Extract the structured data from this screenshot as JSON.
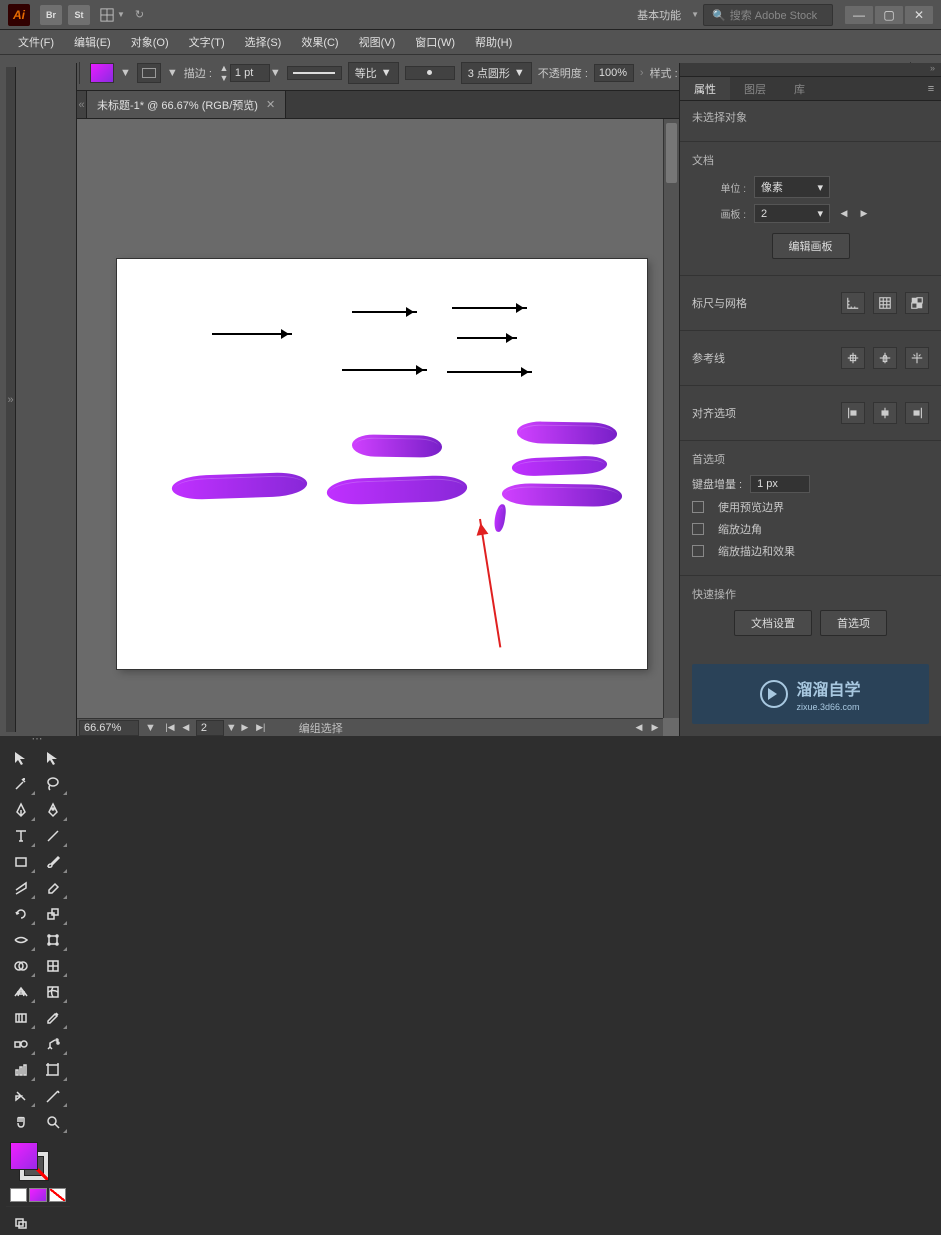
{
  "titlebar": {
    "workspace_label": "基本功能",
    "search_placeholder": "搜索 Adobe Stock"
  },
  "menu": {
    "file": "文件(F)",
    "edit": "编辑(E)",
    "object": "对象(O)",
    "type": "文字(T)",
    "select": "选择(S)",
    "effect": "效果(C)",
    "view": "视图(V)",
    "window": "窗口(W)",
    "help": "帮助(H)"
  },
  "optbar": {
    "selection": "未选择对象",
    "stroke_label": "描边 :",
    "stroke_weight": "1 pt",
    "equal_label": "等比",
    "profile_label": "3 点圆形",
    "opacity_label": "不透明度 :",
    "opacity_value": "100%",
    "style_label": "样式 :"
  },
  "document": {
    "tab_title": "未标题-1* @ 66.67% (RGB/预览)"
  },
  "statusbar": {
    "zoom": "66.67%",
    "artboard_num": "2",
    "mode": "编组选择"
  },
  "panel": {
    "tabs": {
      "properties": "属性",
      "layers": "图层",
      "libraries": "库"
    },
    "no_selection": "未选择对象",
    "document_section": "文档",
    "unit_label": "单位 :",
    "unit_value": "像素",
    "artboard_label": "画板 :",
    "artboard_value": "2",
    "edit_artboards_btn": "编辑画板",
    "ruler_grid": "标尺与网格",
    "guides": "参考线",
    "align_options": "对齐选项",
    "preferences": "首选项",
    "keyboard_increment_label": "键盘增量 :",
    "keyboard_increment_value": "1 px",
    "use_preview_bounds": "使用预览边界",
    "scale_corners": "缩放边角",
    "scale_stroke_effects": "缩放描边和效果",
    "quick_actions": "快速操作",
    "doc_setup_btn": "文档设置",
    "prefs_btn": "首选项"
  },
  "watermark": {
    "brand": "溜溜自学",
    "url": "zixue.3d66.com"
  }
}
